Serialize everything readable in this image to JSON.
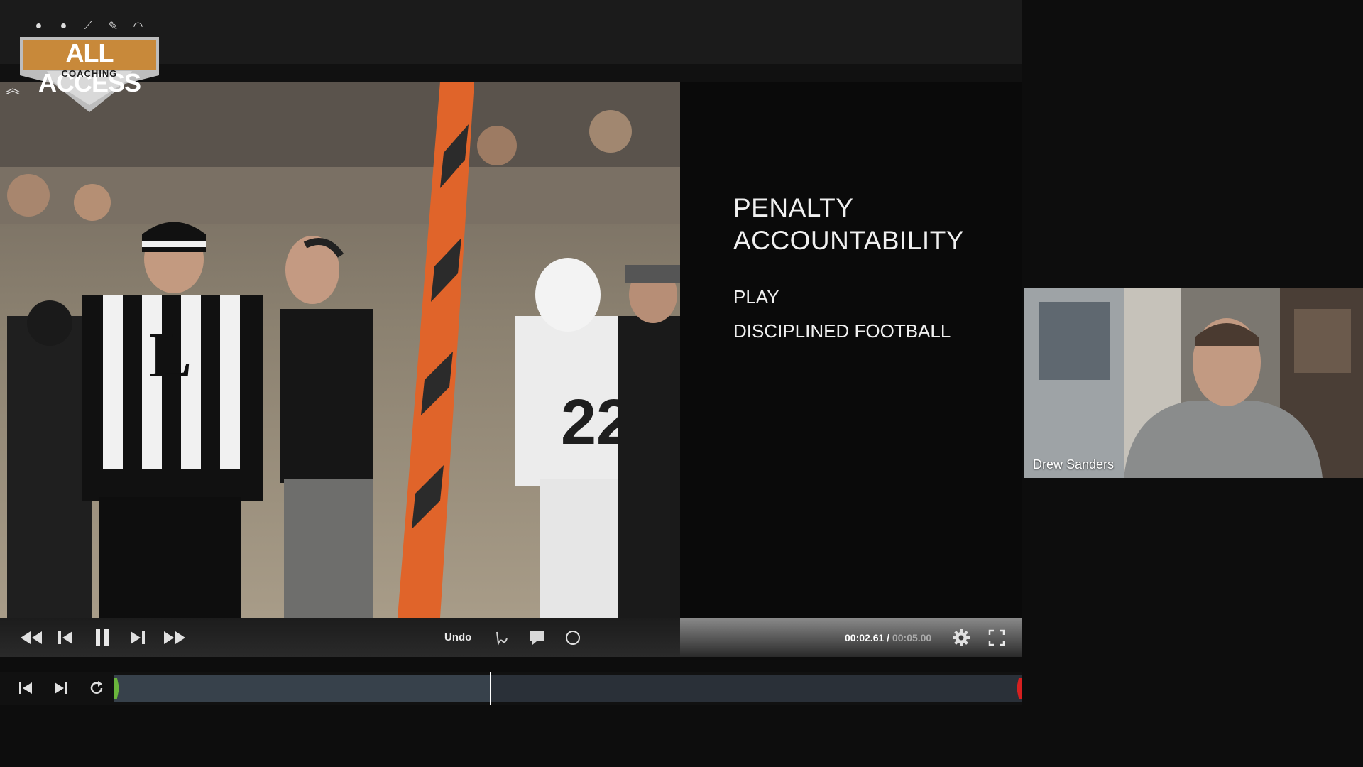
{
  "logo": {
    "title": "ALL ACCESS",
    "subtitle": "COACHING",
    "icons": [
      "baseball-icon",
      "ball-icon",
      "bat-icon",
      "wrench-icon",
      "helmet-icon"
    ]
  },
  "slide": {
    "title_line1": "PENALTY",
    "title_line2": "ACCOUNTABILITY",
    "bullets": [
      "PLAY",
      "DISCIPLINED FOOTBALL"
    ]
  },
  "transport": {
    "undo_label": "Undo",
    "current_time": "00:02.61",
    "separator": " / ",
    "total_time": "00:05.00",
    "buttons": [
      "rewind",
      "step-back",
      "pause",
      "step-forward",
      "fast-forward",
      "pen",
      "comment",
      "circle",
      "settings",
      "fullscreen"
    ]
  },
  "timeline": {
    "progress": 0.414,
    "controls": [
      "skip-to-start",
      "skip-to-end",
      "loop"
    ]
  },
  "webcam": {
    "participant_name": "Drew Sanders"
  },
  "colors": {
    "accent_gold": "#c8893a",
    "timeline_start": "#6ab53c",
    "timeline_end": "#d62020",
    "background": "#0d0d0d"
  }
}
